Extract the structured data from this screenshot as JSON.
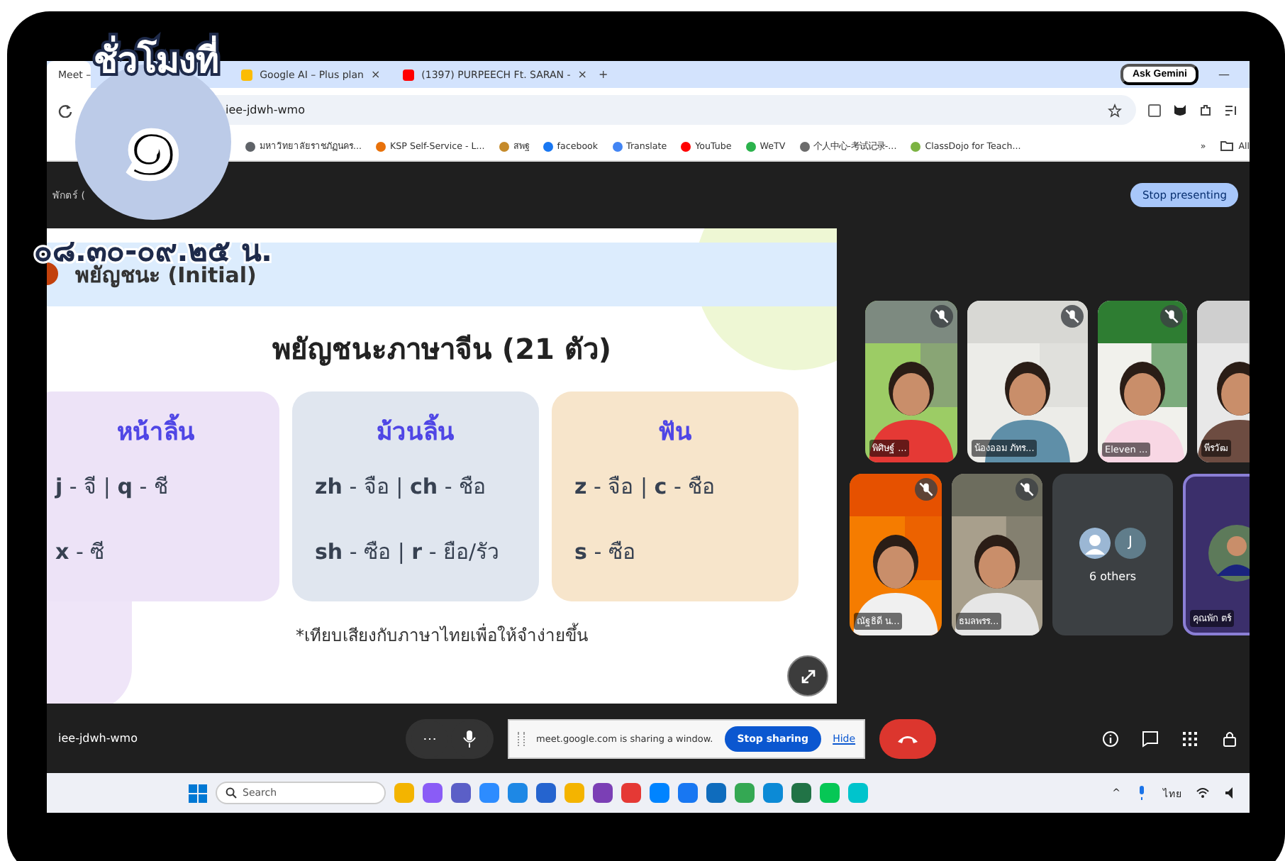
{
  "overlay": {
    "heading": "ชั่วโมงที่",
    "number": "๑",
    "time": "๐๘.๓๐-๐๙.๒๕ น."
  },
  "browser": {
    "tabs": [
      {
        "title": "Meet –",
        "selected": true
      },
      {
        "title": "Google AI – Plus plan",
        "close": "×",
        "selected": false
      },
      {
        "title": "(1397) PURPEECH Ft. SARAN -",
        "close": "×",
        "selected": false
      }
    ],
    "new_tab": "+",
    "ask_button": "Ask Gemini",
    "minimize": "—",
    "address": "iee-jdwh-wmo",
    "bookmarks": [
      {
        "label": "มหาวิทยาลัยราชภัฏนคร...",
        "color": "#5f6368"
      },
      {
        "label": "KSP Self-Service - L...",
        "color": "#e8710a"
      },
      {
        "label": "สพฐ",
        "color": "#c58a2a"
      },
      {
        "label": "facebook",
        "color": "#1877f2"
      },
      {
        "label": "Translate",
        "color": "#4285f4"
      },
      {
        "label": "YouTube",
        "color": "#ff0000"
      },
      {
        "label": "WeTV",
        "color": "#2bb24c"
      },
      {
        "label": "个人中心-考试记录-...",
        "color": "#6b6b6b"
      },
      {
        "label": "ClassDojo for Teach...",
        "color": "#7cb342"
      }
    ],
    "more": "»",
    "all": "All"
  },
  "meet": {
    "presenter": "พักตร์ (",
    "stop_presenting": "Stop presenting",
    "slide": {
      "header": "พยัญชนะ (Initial)",
      "title": "พยัญชนะภาษาจีน (21 ตัว)",
      "cards": [
        {
          "heading": "หน้าลิ้น",
          "color": "#ede3f7",
          "lines": [
            "**j** - จี  | **q** - ชี",
            "**x** - ซี"
          ]
        },
        {
          "heading": "ม้วนลิ้น",
          "color": "#e0e6ef",
          "lines": [
            "**zh** - จือ | **ch** - ชือ",
            "**sh** - ซือ | **r** - ยือ/รัว"
          ]
        },
        {
          "heading": "ฟัน",
          "color": "#f7e5cb",
          "lines": [
            "**z** - จือ | **c** - ชือ",
            "**s** - ซือ"
          ]
        }
      ],
      "note": "*เทียบเสียงกับภาษาไทยเพื่อให้จำง่ายขึ้น"
    },
    "tiles": [
      [
        {
          "kind": "video",
          "name": "พิศิษฐ์ ...",
          "muted": true
        },
        {
          "kind": "video",
          "name": "น้องออม ภัทร...",
          "muted": true
        },
        {
          "kind": "video",
          "name": "Eleven ...",
          "muted": true
        },
        {
          "kind": "video",
          "name": "พีรวัฒ"
        }
      ],
      [
        {
          "kind": "video",
          "name": "ณัฐธิดี น...",
          "muted": true
        },
        {
          "kind": "video",
          "name": "ธมลพรร...",
          "muted": true
        },
        {
          "kind": "others",
          "name": "6 others",
          "initial": "J"
        },
        {
          "kind": "presenter",
          "name": "คุณพัก ตร์"
        }
      ]
    ],
    "meeting_code": "iee-jdwh-wmo",
    "more_button": "⋯",
    "share_notice": {
      "text": "meet.google.com is sharing a window.",
      "stop": "Stop sharing",
      "hide": "Hide"
    }
  },
  "taskbar": {
    "search": "Search",
    "chevron": "^",
    "language": "ไทย"
  }
}
